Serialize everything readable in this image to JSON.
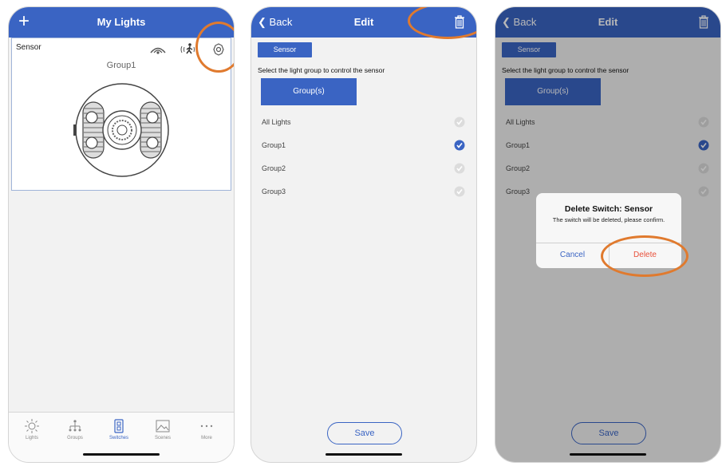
{
  "screen1": {
    "title": "My Lights",
    "add_label": "+",
    "card": {
      "name": "Sensor",
      "group": "Group1"
    },
    "tabs": [
      {
        "label": "Lights",
        "icon": "sun-icon"
      },
      {
        "label": "Groups",
        "icon": "hierarchy-icon"
      },
      {
        "label": "Switches",
        "icon": "switch-icon"
      },
      {
        "label": "Scenes",
        "icon": "image-icon"
      },
      {
        "label": "More",
        "icon": "more-icon"
      }
    ]
  },
  "screen2": {
    "back_label": "Back",
    "title": "Edit",
    "tag": "Sensor",
    "instruction": "Select the light group to control the sensor",
    "groups_button": "Group(s)",
    "rows": [
      {
        "label": "All Lights",
        "selected": false
      },
      {
        "label": "Group1",
        "selected": true
      },
      {
        "label": "Group2",
        "selected": false
      },
      {
        "label": "Group3",
        "selected": false
      }
    ],
    "save_label": "Save"
  },
  "screen3": {
    "back_label": "Back",
    "title": "Edit",
    "tag": "Sensor",
    "instruction": "Select the light group to control the sensor",
    "groups_button": "Group(s)",
    "rows": [
      {
        "label": "All Lights",
        "selected": false
      },
      {
        "label": "Group1",
        "selected": true
      },
      {
        "label": "Group2",
        "selected": false
      },
      {
        "label": "Group3",
        "selected": false
      }
    ],
    "save_label": "Save",
    "dialog": {
      "title": "Delete Switch: Sensor",
      "message": "The switch will be deleted, please confirm.",
      "cancel": "Cancel",
      "delete": "Delete"
    }
  },
  "colors": {
    "primary": "#3a64c3",
    "highlight": "#e07a2e",
    "danger": "#e8503a"
  }
}
